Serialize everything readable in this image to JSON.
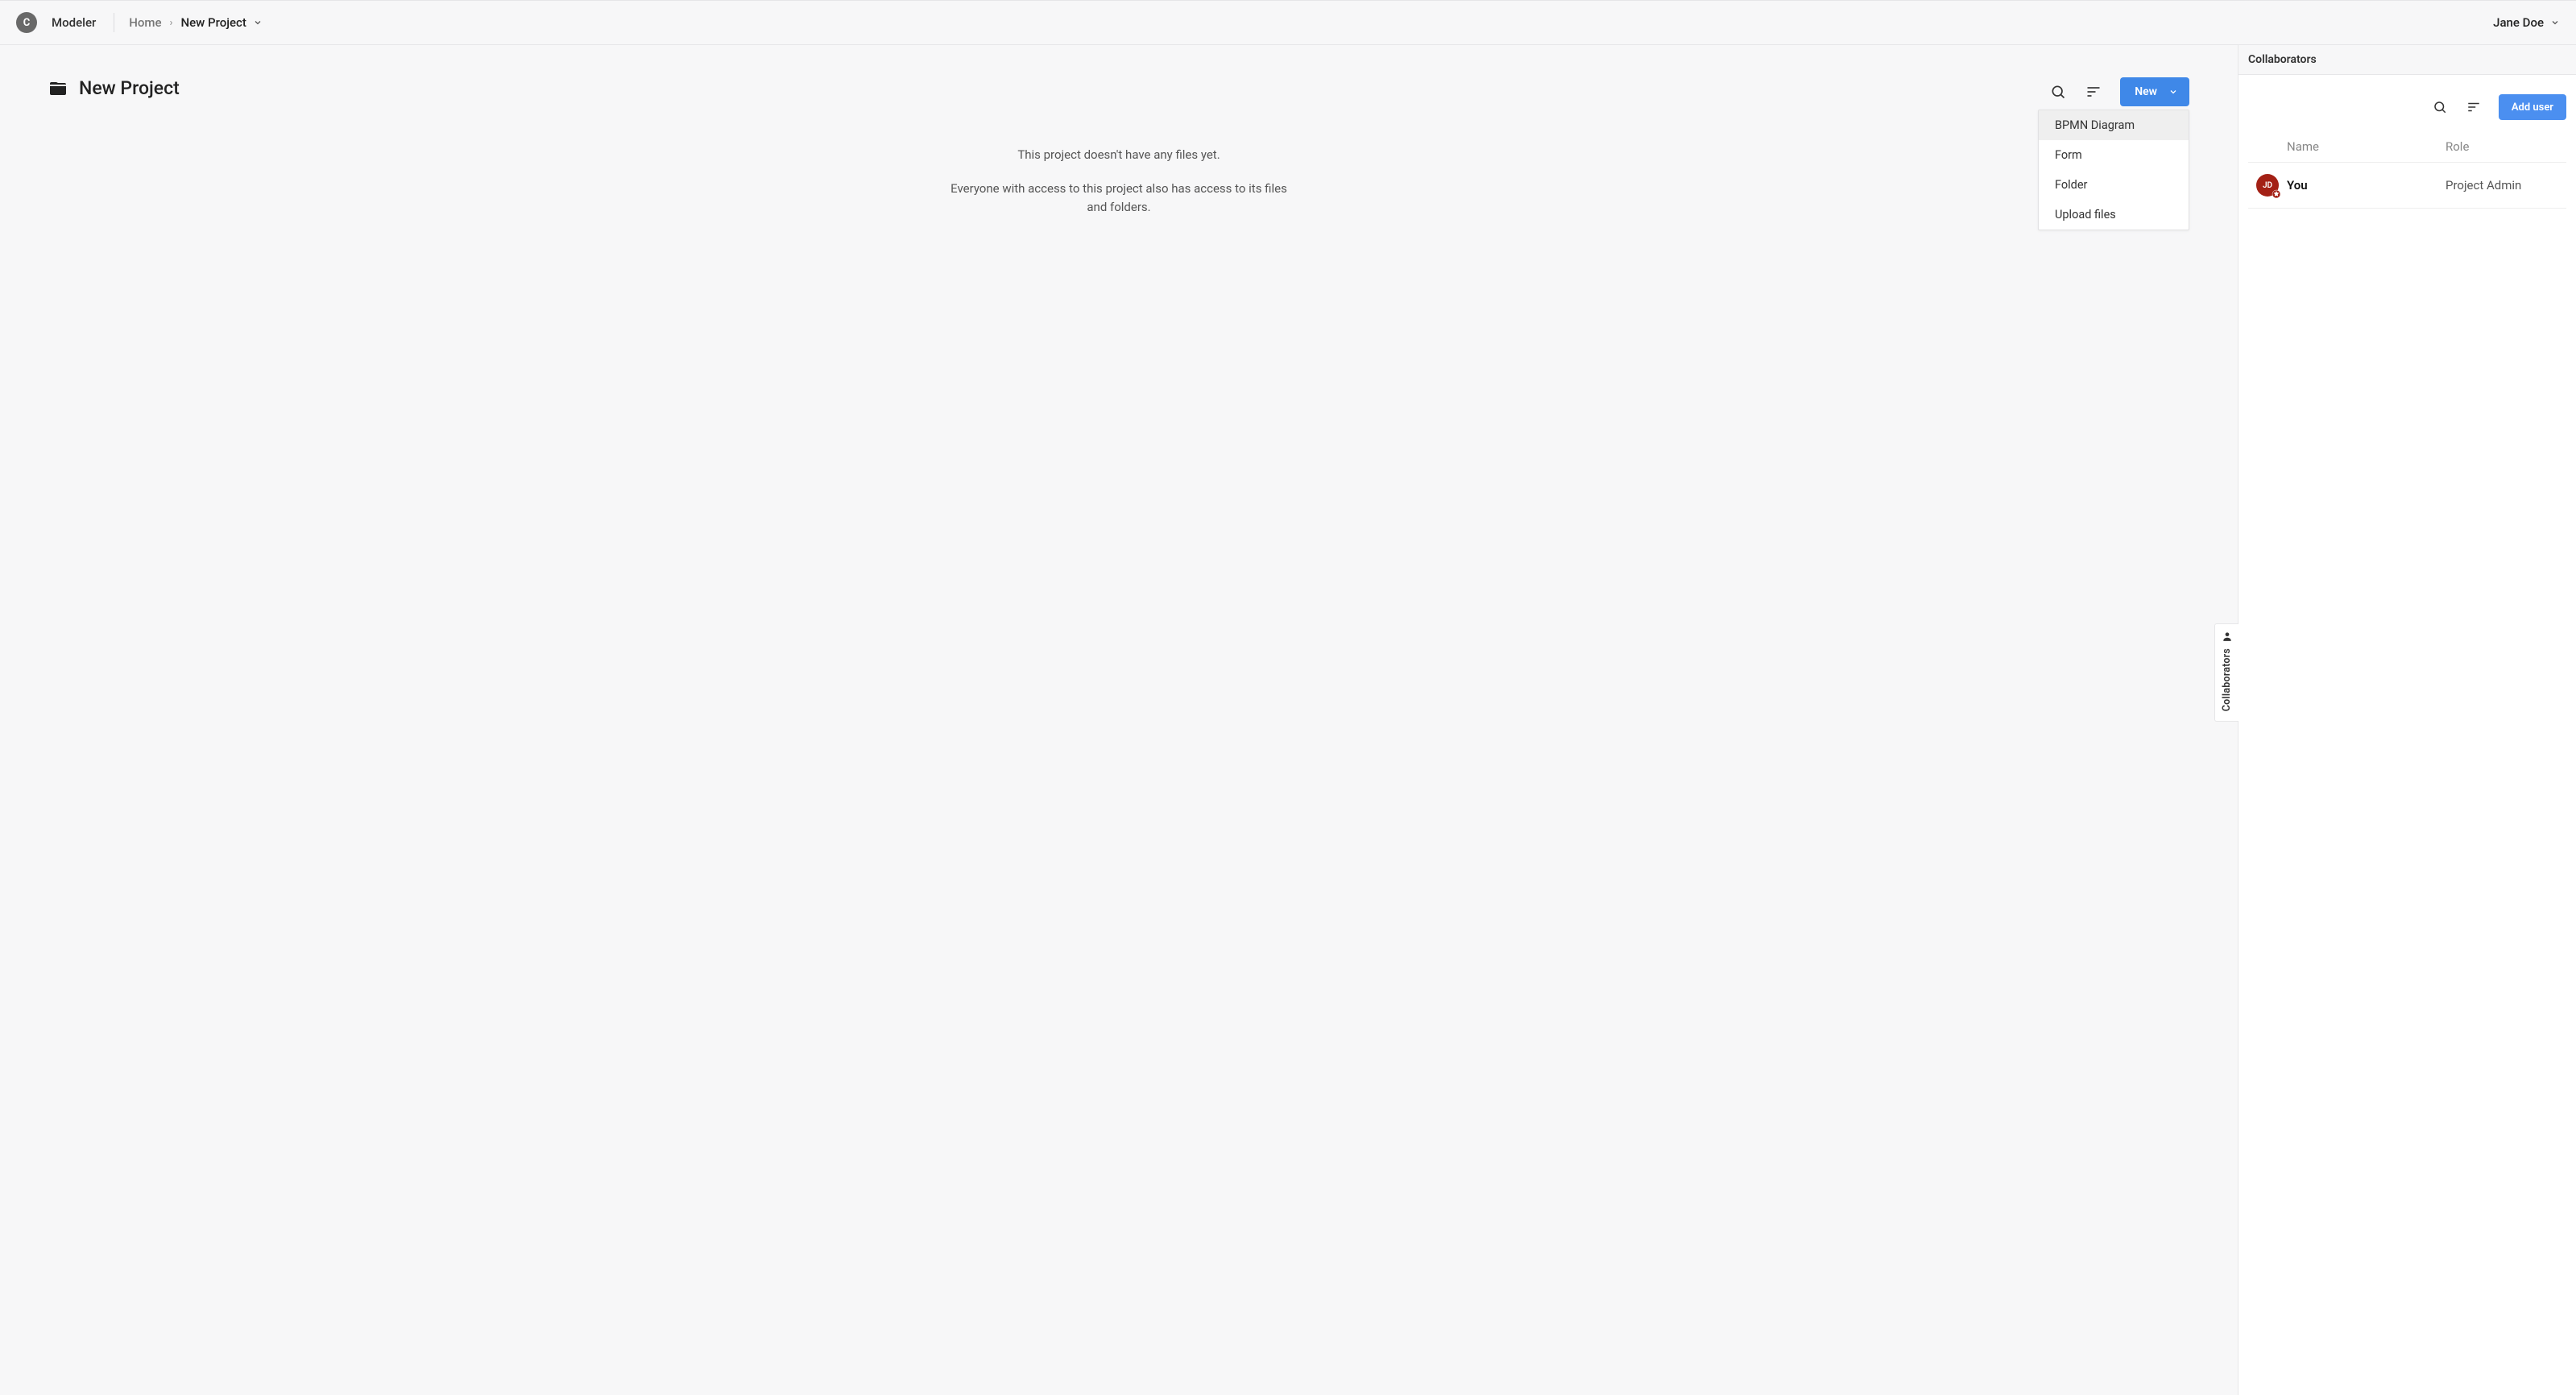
{
  "app_name": "Modeler",
  "logo_letter": "C",
  "breadcrumb": {
    "home": "Home",
    "sep": "›",
    "current": "New Project"
  },
  "user": {
    "name": "Jane Doe"
  },
  "project": {
    "title": "New Project"
  },
  "empty_state": {
    "line1": "This project doesn't have any files yet.",
    "line2": "Everyone with access to this project also has access to its files and folders."
  },
  "toolbar": {
    "new_button": "New"
  },
  "new_dropdown": {
    "items": [
      {
        "label": "BPMN Diagram",
        "hover": true
      },
      {
        "label": "Form",
        "hover": false
      },
      {
        "label": "Folder",
        "hover": false
      },
      {
        "label": "Upload files",
        "hover": false
      }
    ]
  },
  "collaborators": {
    "panel_title": "Collaborators",
    "add_button": "Add user",
    "columns": {
      "name": "Name",
      "role": "Role"
    },
    "rows": [
      {
        "initials": "JD",
        "name": "You",
        "role": "Project Admin"
      }
    ]
  }
}
